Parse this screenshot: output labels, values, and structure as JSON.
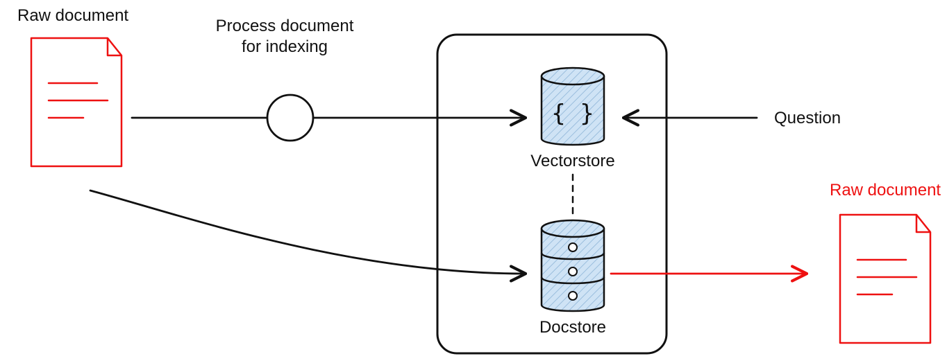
{
  "labels": {
    "raw_document_left": "Raw document",
    "process_document_line1": "Process document",
    "process_document_line2": "for indexing",
    "vectorstore": "Vectorstore",
    "docstore": "Docstore",
    "question": "Question",
    "raw_document_right": "Raw document"
  },
  "icons": {
    "vectorstore_glyph": "{ }"
  },
  "colors": {
    "black": "#111111",
    "red": "#ee1111",
    "cylinder_fill": "#cfe3f5",
    "white": "#ffffff"
  }
}
